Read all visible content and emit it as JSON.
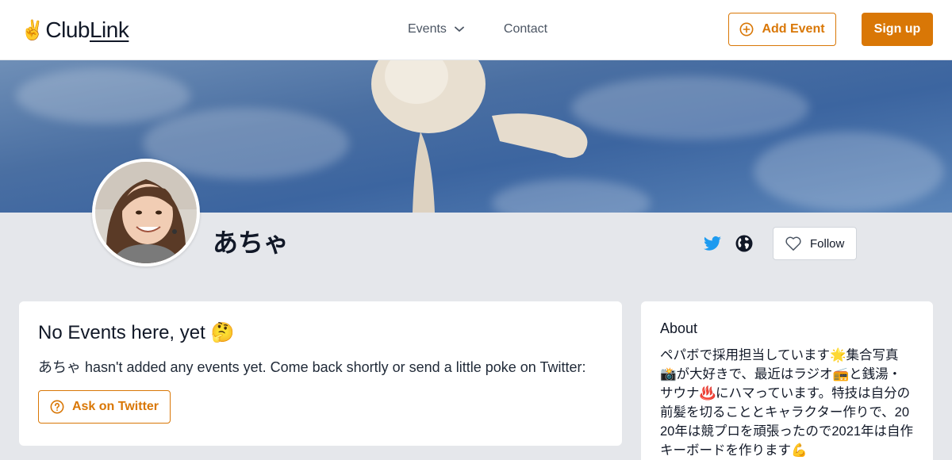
{
  "header": {
    "logo_emoji": "✌️",
    "logo_club": "Club",
    "logo_link": "Link",
    "nav_events": "Events",
    "nav_contact": "Contact",
    "add_event": "Add Event",
    "sign_up": "Sign up"
  },
  "profile": {
    "name": "あちゃ",
    "follow": "Follow"
  },
  "events_card": {
    "title": "No Events here, yet 🤔",
    "message": "あちゃ hasn't added any events yet. Come back shortly or send a little poke on Twitter:",
    "ask_button": "Ask on Twitter"
  },
  "about": {
    "title": "About",
    "text": "ペパボで採用担当しています🌟集合写真📸が大好きで、最近はラジオ📻と銭湯・サウナ♨️にハマっています。特技は自分の前髪を切ることとキャラクター作りで、2020年は競プロを頑張ったので2021年は自作キーボードを作ります💪"
  },
  "colors": {
    "accent": "#d97706",
    "twitter": "#1d9bf0",
    "page_bg": "#e5e7eb"
  },
  "icons": [
    "chevron-down-icon",
    "plus-circle-icon",
    "twitter-icon",
    "globe-icon",
    "heart-icon",
    "question-circle-icon"
  ]
}
